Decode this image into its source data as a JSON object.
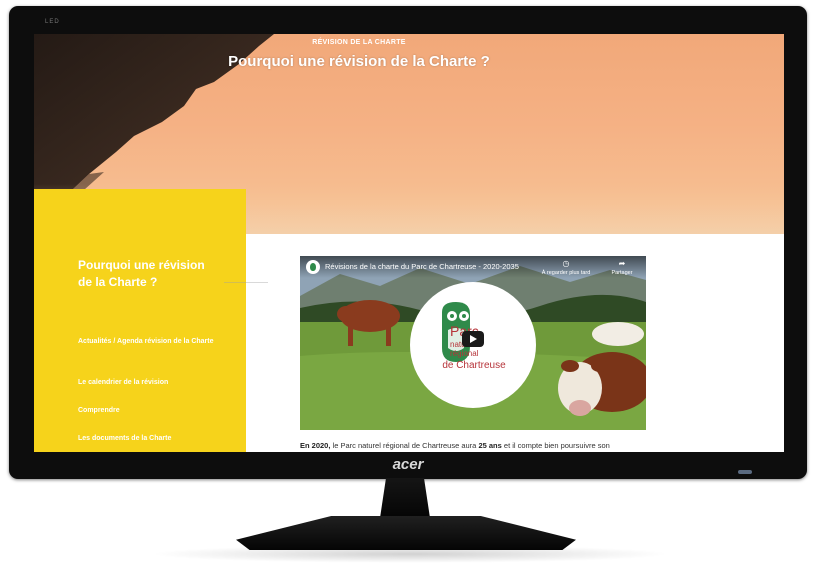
{
  "monitor": {
    "brand": "acer",
    "model_label": "LED"
  },
  "hero": {
    "kicker": "RÉVISION DE LA CHARTE",
    "title": "Pourquoi une révision de la Charte ?"
  },
  "sidebar": {
    "title": "Pourquoi une révision de la Charte ?",
    "links": [
      "Actualités / Agenda révision de la Charte",
      "Le calendrier de la révision",
      "Comprendre",
      "Les documents de la Charte"
    ]
  },
  "video": {
    "title": "Révisions de la charte du Parc de Chartreuse - 2020-2035",
    "watch_later": "À regarder plus tard",
    "share": "Partager",
    "logo": {
      "line1": "Parc",
      "line2": "naturel",
      "line3": "régional",
      "line4": "de Chartreuse"
    }
  },
  "intro": {
    "lead_bold": "En 2020,",
    "text_a": " le Parc naturel régional de Chartreuse aura ",
    "years_bold": "25 ans",
    "text_b": " et il compte bien poursuivre son"
  },
  "colors": {
    "sidebar": "#f6d31b",
    "logo_red": "#b6343a",
    "logo_green": "#2f8a4a"
  }
}
